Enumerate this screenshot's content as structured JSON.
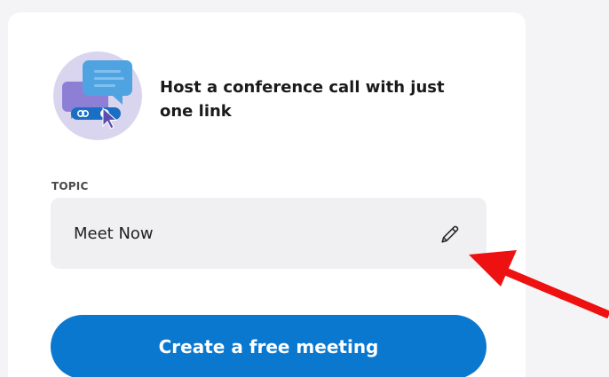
{
  "card": {
    "headline": "Host a conference call with just one link",
    "illustration_icon": "conference-link-icon"
  },
  "topic": {
    "label": "TOPIC",
    "value": "Meet Now",
    "edit_icon": "pencil-icon"
  },
  "cta": {
    "label": "Create a free meeting"
  },
  "colors": {
    "primary": "#0b78cf",
    "field_bg": "#f0f0f2",
    "annotation_arrow": "#ee1111"
  }
}
